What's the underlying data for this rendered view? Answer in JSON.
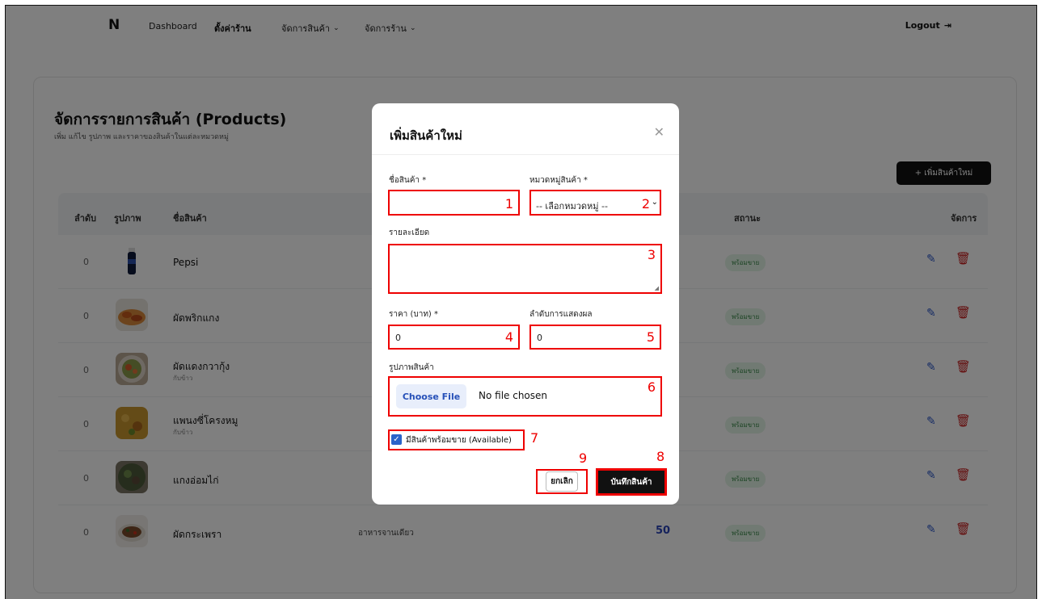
{
  "nav": {
    "logo": "N",
    "items": [
      {
        "label": "Dashboard",
        "chevron": false
      },
      {
        "label": "ตั้งค่าร้าน",
        "chevron": false
      },
      {
        "label": "จัดการสินค้า",
        "chevron": true
      },
      {
        "label": "จัดการร้าน",
        "chevron": true
      }
    ],
    "logout_label": "Logout",
    "logout_icon": "logout-icon"
  },
  "page": {
    "title": "จัดการรายการสินค้า (Products)",
    "subtitle": "เพิ่ม แก้ไข รูปภาพ และราคาของสินค้าในแต่ละหมวดหมู่",
    "add_button": "+ เพิ่มสินค้าใหม่"
  },
  "table": {
    "headers": {
      "index": "ลำดับ",
      "image": "รูปภาพ",
      "name": "ชื่อสินค้า",
      "status": "สถานะ",
      "actions": "จัดการ"
    },
    "rows": [
      {
        "index": "0",
        "name": "Pepsi",
        "sub": "",
        "status": "พร้อมขาย",
        "category": "",
        "price": ""
      },
      {
        "index": "0",
        "name": "ผัดพริกแกง",
        "sub": "",
        "status": "พร้อมขาย",
        "category": "",
        "price": ""
      },
      {
        "index": "0",
        "name": "ผัดแดงกวากุ้ง",
        "sub": "กับข้าว",
        "status": "พร้อมขาย",
        "category": "",
        "price": ""
      },
      {
        "index": "0",
        "name": "แพนงซี่โครงหมู",
        "sub": "กับข้าว",
        "status": "พร้อมขาย",
        "category": "",
        "price": ""
      },
      {
        "index": "0",
        "name": "แกงอ่อมไก่",
        "sub": "",
        "status": "พร้อมขาย",
        "category": "",
        "price": ""
      },
      {
        "index": "0",
        "name": "ผัดกระเพรา",
        "sub": "",
        "status": "พร้อมขาย",
        "category": "อาหารจานเดียว",
        "price": "50"
      }
    ]
  },
  "modal": {
    "title": "เพิ่มสินค้าใหม่",
    "close_icon": "close-icon",
    "fields": {
      "name": {
        "label": "ชื่อสินค้า *",
        "value": "",
        "marker": "1"
      },
      "category": {
        "label": "หมวดหมู่สินค้า *",
        "value": "-- เลือกหมวดหมู่ --",
        "marker": "2"
      },
      "description": {
        "label": "รายละเอียด",
        "value": "",
        "marker": "3"
      },
      "price": {
        "label": "ราคา (บาท) *",
        "value": "0",
        "marker": "4"
      },
      "order": {
        "label": "ลำดับการแสดงผล",
        "value": "0",
        "marker": "5"
      },
      "image": {
        "label": "รูปภาพสินค้า",
        "button": "Choose File",
        "status": "No file chosen",
        "marker": "6"
      },
      "available": {
        "label": "มีสินค้าพร้อมขาย (Available)",
        "checked": true,
        "marker": "7"
      }
    },
    "save_button": {
      "label": "บันทึกสินค้า",
      "marker": "8"
    },
    "cancel_button": {
      "label": "ยกเลิก",
      "marker": "9"
    }
  },
  "colors": {
    "accent": "#111111",
    "annotation": "#ee0000",
    "badge_bg": "#e3f4e6",
    "badge_text": "#3b8a4b",
    "edit_icon": "#2955c8",
    "delete_icon": "#c81b1b"
  }
}
